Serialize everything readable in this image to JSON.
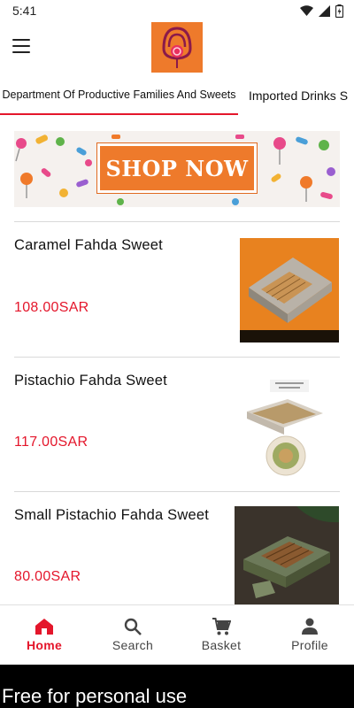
{
  "status_bar": {
    "time": "5:41",
    "icons": [
      "wifi-icon",
      "signal-icon",
      "battery-icon"
    ]
  },
  "header": {
    "logo": "store-logo-icon",
    "menu_icon": "hamburger-menu-icon"
  },
  "tabs": [
    {
      "label": "Department Of Productive Families And Sweets",
      "active": true
    },
    {
      "label": "Imported Drinks S",
      "active": false
    }
  ],
  "banner": {
    "button_text": "SHOP NOW"
  },
  "products": [
    {
      "name": "Caramel Fahda Sweet",
      "price": "108.00SAR"
    },
    {
      "name": "Pistachio Fahda Sweet",
      "price": "117.00SAR"
    },
    {
      "name": "Small Pistachio Fahda Sweet",
      "price": "80.00SAR"
    }
  ],
  "bottom_nav": [
    {
      "label": "Home",
      "icon": "home-icon",
      "active": true
    },
    {
      "label": "Search",
      "icon": "search-icon",
      "active": false
    },
    {
      "label": "Basket",
      "icon": "cart-icon",
      "active": false
    },
    {
      "label": "Profile",
      "icon": "person-icon",
      "active": false
    }
  ],
  "watermark": "Free for personal use",
  "colors": {
    "accent": "#e4162b",
    "brand_orange": "#ee7a2b"
  }
}
